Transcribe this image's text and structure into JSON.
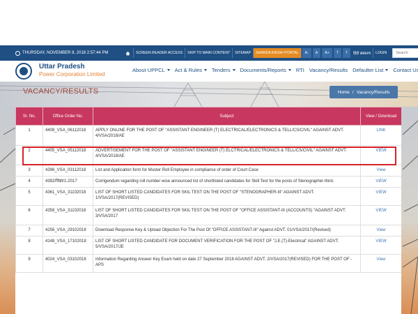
{
  "topbar": {
    "date": "THURSDAY, NOVEMBER 8, 2018 2:57:44 PM",
    "links": [
      "SCREEN READER ACCESS",
      "SKIP TO MAIN CONTENT",
      "SITEMAP"
    ],
    "highlight_link": "SHARDA KAISHI PORTAL",
    "font_sizes": [
      "A-",
      "A",
      "A+"
    ],
    "theme_toggles": [
      "T",
      "T"
    ],
    "language": "हिंदी संस्करण",
    "login": "LOGIN",
    "search_placeholder": "Search"
  },
  "brand": {
    "line1": "Uttar Pradesh",
    "line2": "Power Corporation Limited"
  },
  "nav": {
    "items": [
      {
        "label": "About UPPCL",
        "dropdown": true
      },
      {
        "label": "Act & Rules",
        "dropdown": true
      },
      {
        "label": "Tenders",
        "dropdown": true
      },
      {
        "label": "Documents/Reports",
        "dropdown": true
      },
      {
        "label": "RTI",
        "dropdown": false
      },
      {
        "label": "Vacancy/Results",
        "dropdown": false
      },
      {
        "label": "Defaulter List",
        "dropdown": true
      },
      {
        "label": "Contact Us",
        "dropdown": true
      }
    ]
  },
  "banner": {
    "title": "VACANCY/RESULTS",
    "breadcrumb_home": "Home",
    "breadcrumb_sep": "/",
    "breadcrumb_current": "Vacancy/Results"
  },
  "table": {
    "headers": {
      "sr": "Sr. No.",
      "order": "Office Order No.",
      "subject": "Subject",
      "action": "View / Download"
    },
    "rows": [
      {
        "sr": "1",
        "order": "4408_VSA_06112018",
        "subject": "APPLY ONLINE FOR THE POST OF \"ASSISTANT ENGINEER (T) ELECTRICAL/ELECTRONICS & TELL/CS/CIVIL\" AGAINST ADVT. 4/VSA/2018/AE",
        "action": "LINK"
      },
      {
        "sr": "2",
        "order": "4405_VSA_05112018",
        "subject": "ADVERTISEMENT FOR THE POST OF \"ASSISTANT ENGINEER (T) ELCTRICAL/ELECTRONICS & TELL/CS/CIVIL\" AGAINST ADVT. 4/VSA/2018/AE",
        "action": "VIEW"
      },
      {
        "sr": "3",
        "order": "4396_VSA_03112018",
        "subject": "List and Application form for Muster Roll Employee in compliance of order of Court Case",
        "action": "View"
      },
      {
        "sr": "4",
        "order": "4392/विज्ञा/1-2017",
        "subject": "Corrigendum regarding roll number wise announced list of shortlisted candidates for Skill Test for the posts of Stenographer-third.",
        "action": "VIEW"
      },
      {
        "sr": "5",
        "order": "4361_VSA_31102018",
        "subject": "LIST OF SHORT LISTED CANDIDATES FOR SKIL TEST ON THE POST OF \"STENOGRAPHER-III\" AGAINST ADVT. 1/VSA/2017(REVISED)",
        "action": "VIEW"
      },
      {
        "sr": "6",
        "order": "4358_VSA_31102018",
        "subject": "LIST OF SHORT LISTED CANDIDATES FOR SKIL TEST ON THE POST OF \"OFFICE ASSISTANT-III (ACCOUNTS) \"AGAINST ADVT. 3/VSA/2017",
        "action": "VIEW"
      },
      {
        "sr": "7",
        "order": "4256_VSA_29102018",
        "subject": "Download Response Key & Upload Objection For The Post Of \"OFFICE ASSISTANT-III\" Against ADVT. 01/VSA/2017/(Revised)",
        "action": "View"
      },
      {
        "sr": "8",
        "order": "4148_VSA_17102018",
        "subject": "LIST OF SHORT LISTED CANDIDATE FOR DOCUMENT VERIFICATION FOR THE POST OF \"J.E.(T)-Electrical\" AGAINST ADVT. 5/VSA/2017/JE",
        "action": "VIEW"
      },
      {
        "sr": "9",
        "order": "4024_VSA_03102018",
        "subject": "Information Regarding Answer Key Exam held on date 27 September 2018 AGAINST ADVT. 2/VSA/2017(REVISED) FOR THE POST OF -APS",
        "action": "View"
      }
    ]
  },
  "colors": {
    "topbar": "#1f4f83",
    "header_row": "#c7375f",
    "highlight_box": "#d82027",
    "link": "#3c73b3",
    "accent_orange": "#e48b22"
  }
}
